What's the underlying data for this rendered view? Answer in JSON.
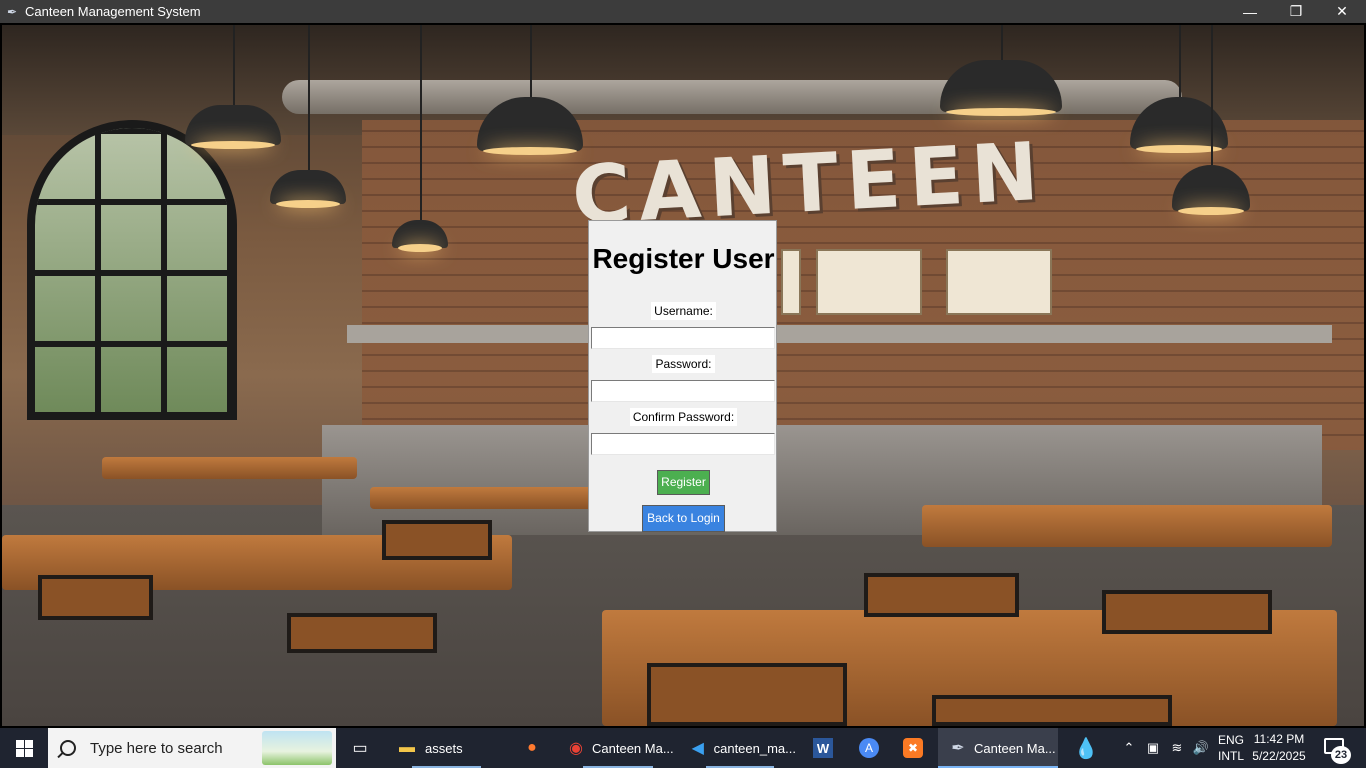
{
  "window": {
    "title": "Canteen Management System",
    "controls": {
      "minimize": "—",
      "maximize": "❐",
      "close": "✕"
    }
  },
  "background": {
    "sign_text": "CANTEEN"
  },
  "register_dialog": {
    "heading": "Register User",
    "fields": [
      {
        "label": "Username:",
        "value": ""
      },
      {
        "label": "Password:",
        "value": ""
      },
      {
        "label": "Confirm Password:",
        "value": ""
      }
    ],
    "register_button": "Register",
    "back_button": "Back to Login"
  },
  "taskbar": {
    "search_placeholder": "Type here to search",
    "items": [
      {
        "label": "",
        "icon": "task-view-icon"
      },
      {
        "label": "assets",
        "icon": "folder-icon"
      },
      {
        "label": "",
        "icon": "firefox-icon"
      },
      {
        "label": "Canteen Ma...",
        "icon": "chrome-icon"
      },
      {
        "label": "canteen_ma...",
        "icon": "vscode-icon"
      },
      {
        "label": "",
        "icon": "word-icon"
      },
      {
        "label": "",
        "icon": "app-store-icon"
      },
      {
        "label": "",
        "icon": "xampp-icon"
      },
      {
        "label": "Canteen Ma...",
        "icon": "python-feather-icon"
      },
      {
        "label": "",
        "icon": "water-drop-icon"
      }
    ],
    "tray": {
      "language_top": "ENG",
      "language_bottom": "INTL",
      "time": "11:42 PM",
      "date": "5/22/2025",
      "notification_count": "23"
    }
  },
  "colors": {
    "register_button": "#4caf50",
    "back_button": "#3a83e0",
    "titlebar": "#3c3c3c",
    "taskbar": "#1f2430"
  }
}
